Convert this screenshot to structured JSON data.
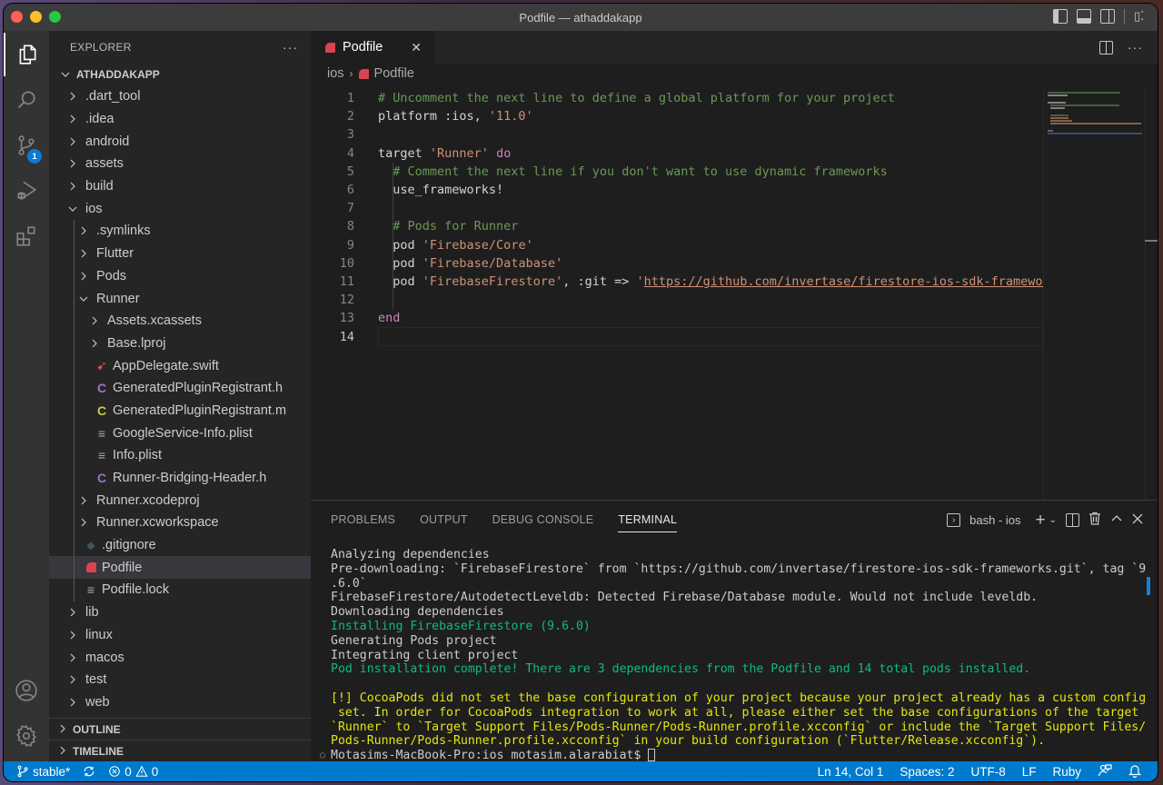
{
  "window": {
    "title": "Podfile — athaddakapp"
  },
  "activity_bar": {
    "items": [
      {
        "name": "explorer",
        "active": true
      },
      {
        "name": "search"
      },
      {
        "name": "source-control",
        "badge": "1"
      },
      {
        "name": "run-and-debug"
      },
      {
        "name": "extensions"
      }
    ],
    "bottom": [
      "accounts",
      "manage"
    ]
  },
  "sidebar": {
    "header": "EXPLORER",
    "more": "···",
    "project": "ATHADDAKAPP",
    "tree": [
      {
        "label": ".dart_tool",
        "type": "folder",
        "depth": 0,
        "expanded": false
      },
      {
        "label": ".idea",
        "type": "folder",
        "depth": 0,
        "expanded": false
      },
      {
        "label": "android",
        "type": "folder",
        "depth": 0,
        "expanded": false
      },
      {
        "label": "assets",
        "type": "folder",
        "depth": 0,
        "expanded": false
      },
      {
        "label": "build",
        "type": "folder",
        "depth": 0,
        "expanded": false
      },
      {
        "label": "ios",
        "type": "folder",
        "depth": 0,
        "expanded": true
      },
      {
        "label": ".symlinks",
        "type": "folder",
        "depth": 1,
        "expanded": false
      },
      {
        "label": "Flutter",
        "type": "folder",
        "depth": 1,
        "expanded": false
      },
      {
        "label": "Pods",
        "type": "folder",
        "depth": 1,
        "expanded": false
      },
      {
        "label": "Runner",
        "type": "folder",
        "depth": 1,
        "expanded": true
      },
      {
        "label": "Assets.xcassets",
        "type": "folder",
        "depth": 2,
        "expanded": false
      },
      {
        "label": "Base.lproj",
        "type": "folder",
        "depth": 2,
        "expanded": false
      },
      {
        "label": "AppDelegate.swift",
        "type": "swift",
        "depth": 2
      },
      {
        "label": "GeneratedPluginRegistrant.h",
        "type": "c-header",
        "depth": 2
      },
      {
        "label": "GeneratedPluginRegistrant.m",
        "type": "c-source",
        "depth": 2
      },
      {
        "label": "GoogleService-Info.plist",
        "type": "text",
        "depth": 2
      },
      {
        "label": "Info.plist",
        "type": "text",
        "depth": 2
      },
      {
        "label": "Runner-Bridging-Header.h",
        "type": "c-header",
        "depth": 2
      },
      {
        "label": "Runner.xcodeproj",
        "type": "folder",
        "depth": 1,
        "expanded": false
      },
      {
        "label": "Runner.xcworkspace",
        "type": "folder",
        "depth": 1,
        "expanded": false
      },
      {
        "label": ".gitignore",
        "type": "git",
        "depth": 1
      },
      {
        "label": "Podfile",
        "type": "ruby",
        "depth": 1,
        "selected": true
      },
      {
        "label": "Podfile.lock",
        "type": "text",
        "depth": 1
      },
      {
        "label": "lib",
        "type": "folder",
        "depth": 0,
        "expanded": false
      },
      {
        "label": "linux",
        "type": "folder",
        "depth": 0,
        "expanded": false
      },
      {
        "label": "macos",
        "type": "folder",
        "depth": 0,
        "expanded": false
      },
      {
        "label": "test",
        "type": "folder",
        "depth": 0,
        "expanded": false
      },
      {
        "label": "web",
        "type": "folder",
        "depth": 0,
        "expanded": false
      }
    ],
    "sections": [
      "OUTLINE",
      "TIMELINE"
    ]
  },
  "editor": {
    "tab": {
      "label": "Podfile",
      "close": "✕"
    },
    "breadcrumb": [
      "ios",
      "Podfile"
    ],
    "current_line": 14,
    "lines": [
      [
        {
          "t": "# Uncomment the next line to define a global platform for your project",
          "c": "comment"
        }
      ],
      [
        {
          "t": "platform :ios, ",
          "c": ""
        },
        {
          "t": "'11.0'",
          "c": "str"
        }
      ],
      [],
      [
        {
          "t": "target ",
          "c": ""
        },
        {
          "t": "'Runner'",
          "c": "str"
        },
        {
          "t": " ",
          "c": ""
        },
        {
          "t": "do",
          "c": "kw"
        }
      ],
      [
        {
          "t": "  # Comment the next line if you don't want to use dynamic frameworks",
          "c": "comment"
        }
      ],
      [
        {
          "t": "  use_frameworks!",
          "c": ""
        }
      ],
      [],
      [
        {
          "t": "  # Pods for Runner",
          "c": "comment"
        }
      ],
      [
        {
          "t": "  pod ",
          "c": ""
        },
        {
          "t": "'Firebase/Core'",
          "c": "str"
        }
      ],
      [
        {
          "t": "  pod ",
          "c": ""
        },
        {
          "t": "'Firebase/Database'",
          "c": "str"
        }
      ],
      [
        {
          "t": "  pod ",
          "c": ""
        },
        {
          "t": "'FirebaseFirestore'",
          "c": "str"
        },
        {
          "t": ", :git => ",
          "c": ""
        },
        {
          "t": "'",
          "c": "str"
        },
        {
          "t": "https://github.com/invertase/firestore-ios-sdk-frameworks.git",
          "c": "link"
        },
        {
          "t": "'",
          "c": "str"
        }
      ],
      [],
      [
        {
          "t": "end",
          "c": "kw"
        }
      ],
      []
    ]
  },
  "panel": {
    "tabs": [
      {
        "label": "PROBLEMS"
      },
      {
        "label": "OUTPUT"
      },
      {
        "label": "DEBUG CONSOLE"
      },
      {
        "label": "TERMINAL",
        "active": true
      }
    ],
    "terminal_name": "bash - ios",
    "terminal_lines": [
      {
        "t": "Analyzing dependencies",
        "c": ""
      },
      {
        "t": "Pre-downloading: `FirebaseFirestore` from `https://github.com/invertase/firestore-ios-sdk-frameworks.git`, tag `9",
        "c": ""
      },
      {
        "t": ".6.0`",
        "c": ""
      },
      {
        "t": "FirebaseFirestore/AutodetectLeveldb: Detected Firebase/Database module. Would not include leveldb.",
        "c": ""
      },
      {
        "t": "Downloading dependencies",
        "c": ""
      },
      {
        "t": "Installing FirebaseFirestore (9.6.0)",
        "c": "green"
      },
      {
        "t": "Generating Pods project",
        "c": ""
      },
      {
        "t": "Integrating client project",
        "c": ""
      },
      {
        "t": "Pod installation complete! There are 3 dependencies from the Podfile and 14 total pods installed.",
        "c": "green"
      },
      {
        "t": "",
        "c": ""
      },
      {
        "t": "[!] CocoaPods did not set the base configuration of your project because your project already has a custom config",
        "c": "yellow"
      },
      {
        "t": " set. In order for CocoaPods integration to work at all, please either set the base configurations of the target",
        "c": "yellow"
      },
      {
        "t": "`Runner` to `Target Support Files/Pods-Runner/Pods-Runner.profile.xcconfig` or include the `Target Support Files/",
        "c": "yellow"
      },
      {
        "t": "Pods-Runner/Pods-Runner.profile.xcconfig` in your build configuration (`Flutter/Release.xcconfig`).",
        "c": "yellow"
      }
    ],
    "prompt": "Motasims-MacBook-Pro:ios motasim.alarabiat$ "
  },
  "statusbar": {
    "branch": "stable*",
    "errors": "0",
    "warnings": "0",
    "position": "Ln 14, Col 1",
    "spaces": "Spaces: 2",
    "encoding": "UTF-8",
    "eol": "LF",
    "language": "Ruby"
  },
  "colors": {
    "accent": "#007acc",
    "ruby": "#d84451",
    "terminal_green": "#23d18b",
    "terminal_yellow": "#e5e510"
  }
}
